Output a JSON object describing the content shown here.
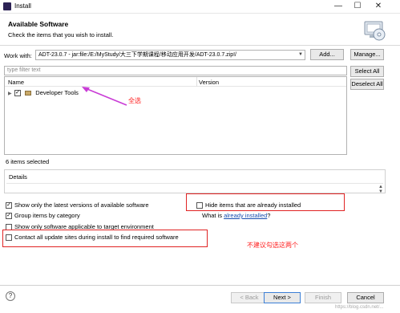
{
  "window": {
    "title": "Install",
    "min": "—",
    "max": "☐",
    "close": "✕"
  },
  "header": {
    "title": "Available Software",
    "subtitle": "Check the items that you wish to install."
  },
  "work_with": {
    "label": "Work with:",
    "value": "ADT-23.0.7 - jar:file:/E:/MyStudy/大三下学期课程/移动应用开发/ADT-23.0.7.zip!/",
    "add_button": "Add...",
    "manage_button": "Manage..."
  },
  "filter": {
    "placeholder": "type filter text"
  },
  "side_buttons": {
    "select_all": "Select All",
    "deselect_all": "Deselect All"
  },
  "tree": {
    "columns": [
      "Name",
      "Version"
    ],
    "items": [
      {
        "label": "Developer Tools",
        "checked": true
      }
    ]
  },
  "selection_count": "6 items selected",
  "details": {
    "label": "Details"
  },
  "options": {
    "latest_versions": {
      "label": "Show only the latest versions of available software",
      "checked": true
    },
    "group_by_category": {
      "label": "Group items by category",
      "checked": true
    },
    "applicable_target": {
      "label": "Show only software applicable to target environment",
      "checked": false
    },
    "contact_all_sites": {
      "label": "Contact all update sites during install to find required software",
      "checked": false
    },
    "hide_installed": {
      "label": "Hide items that are already installed",
      "checked": false
    },
    "what_is_prefix": "What is ",
    "already_installed_link": "already installed",
    "what_is_suffix": "?"
  },
  "annotations": {
    "select_all": "全选",
    "not_recommended": "不建议勾选这两个",
    "arrow_color": "#c93cd6",
    "box_color": "#e02424"
  },
  "footer": {
    "help": "?",
    "back": "< Back",
    "next": "Next >",
    "finish": "Finish",
    "cancel": "Cancel"
  },
  "watermark": "https://blog.csdn.net/..."
}
